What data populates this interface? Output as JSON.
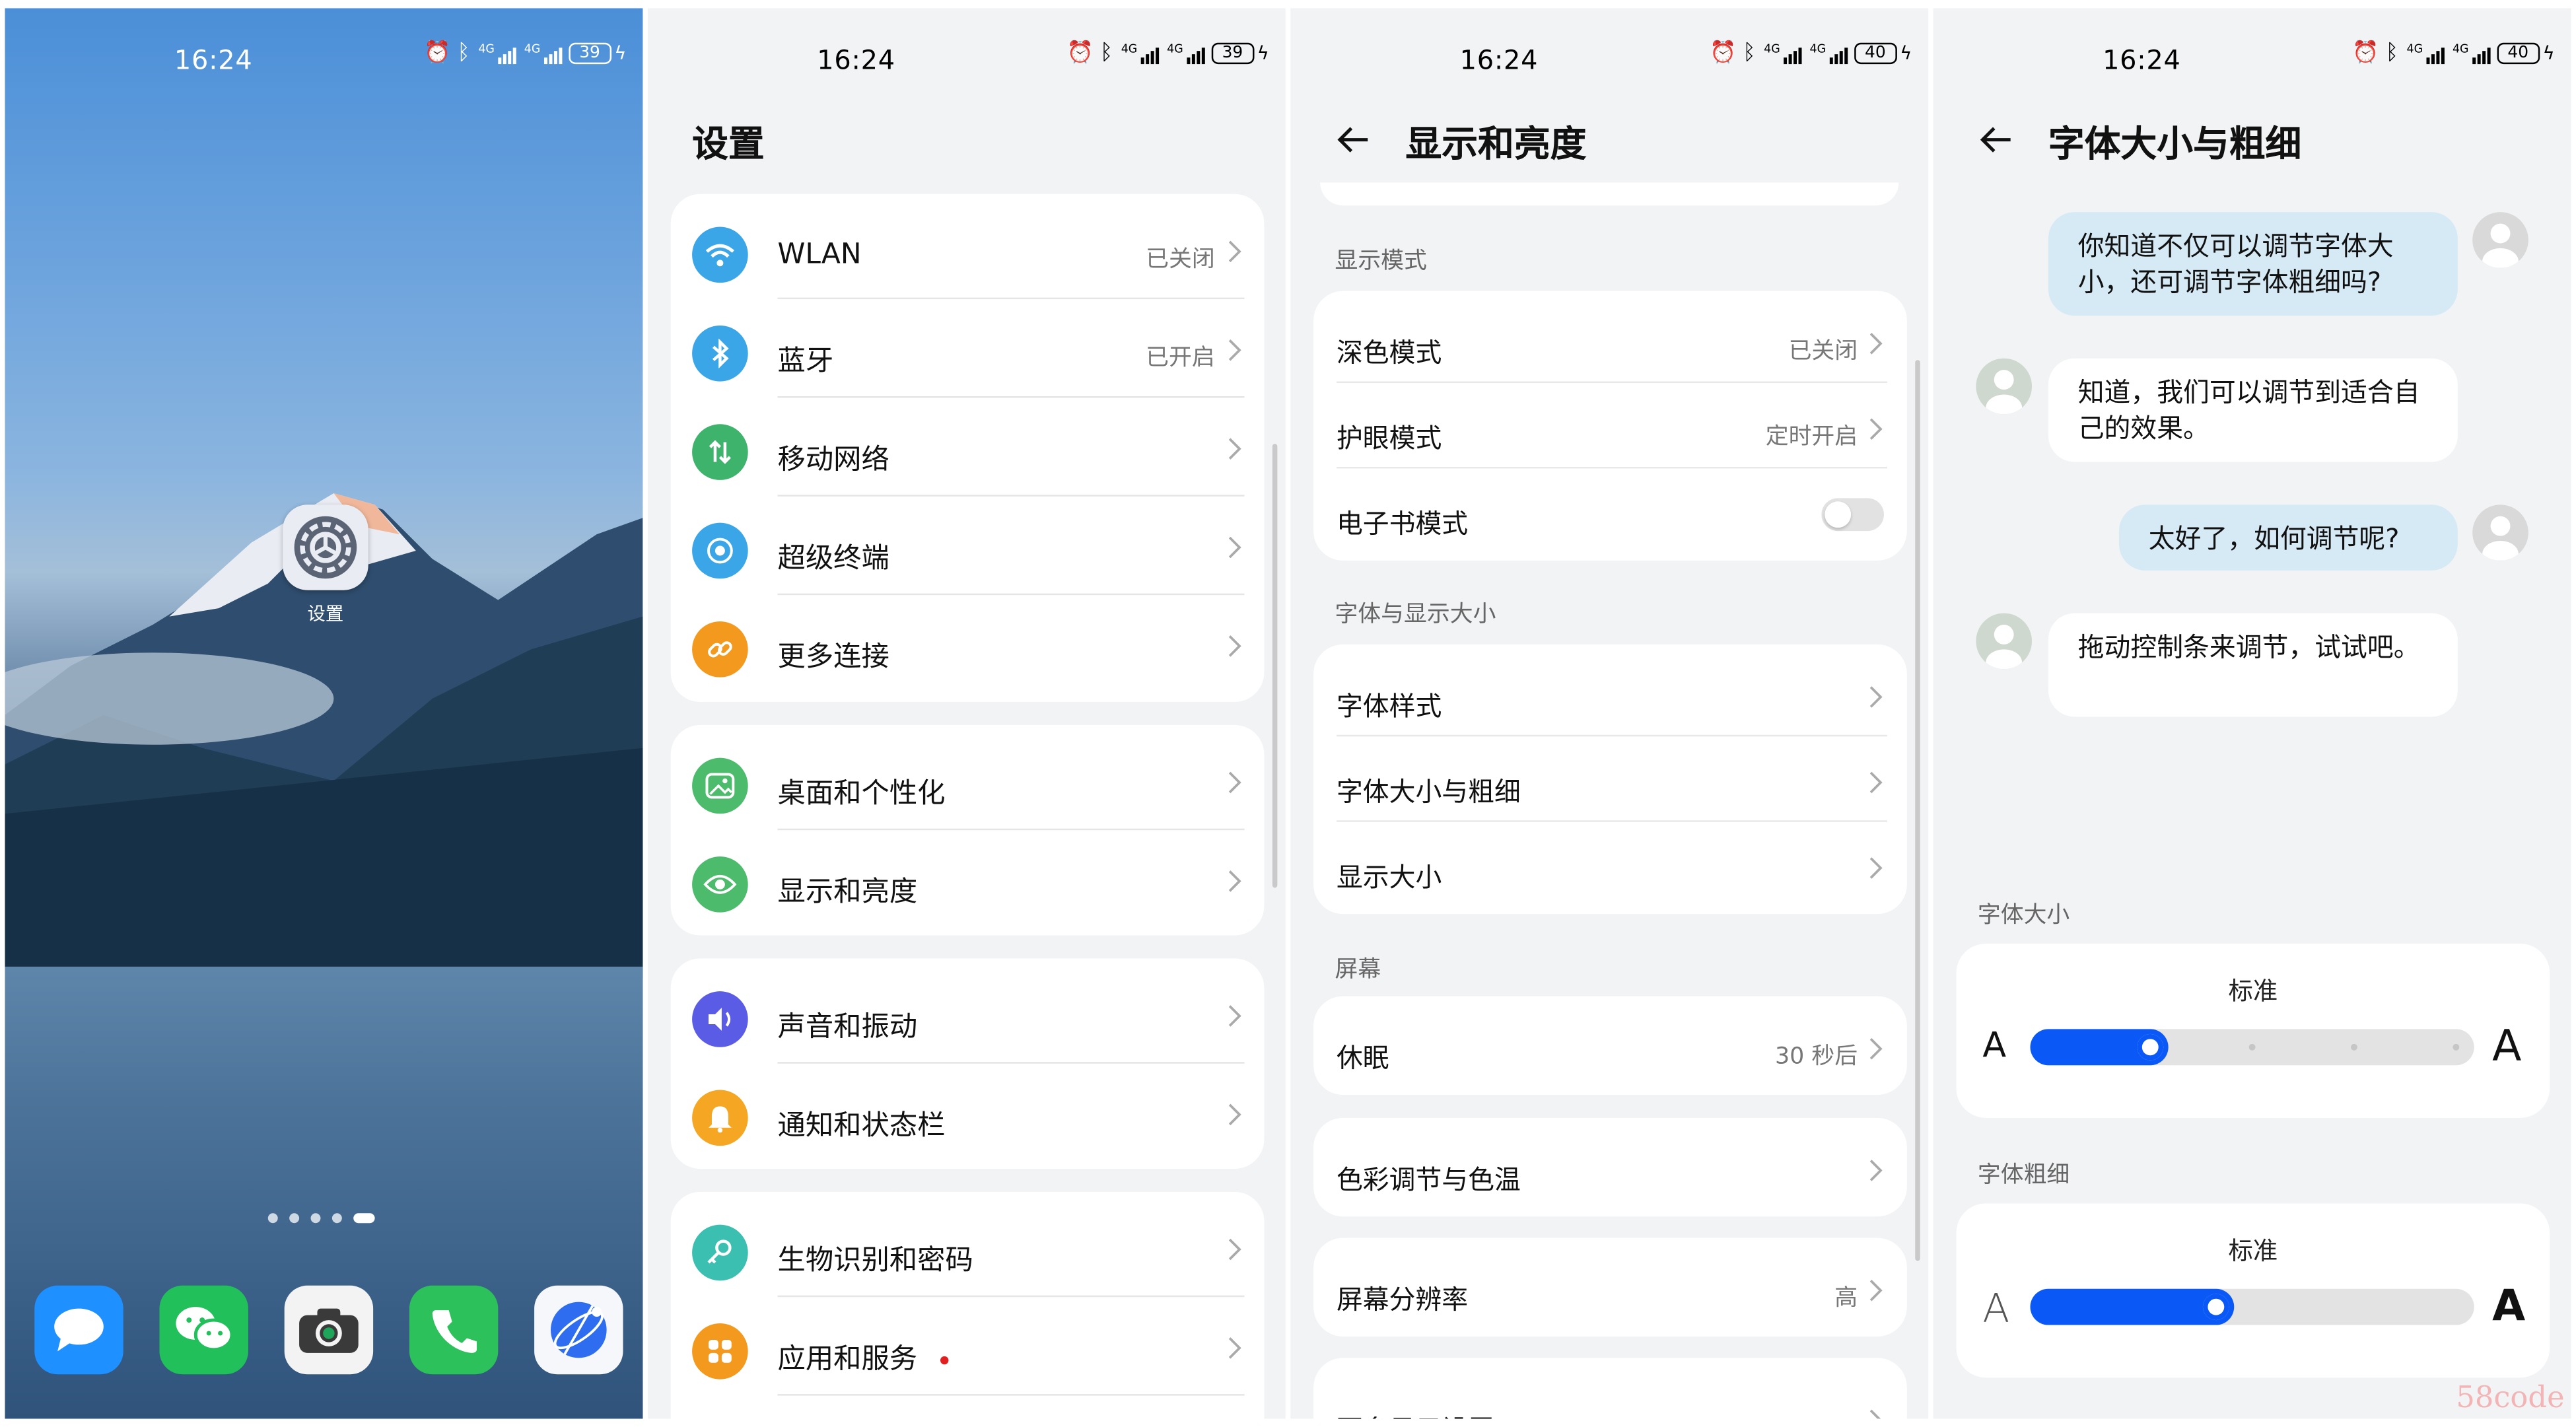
{
  "status": {
    "panel1": {
      "time": "16:24",
      "battery": "39"
    },
    "panel2": {
      "time": "16:24",
      "battery": "39"
    },
    "panel3": {
      "time": "16:24",
      "battery": "40"
    },
    "panel4": {
      "time": "16:24",
      "battery": "40"
    },
    "net_label": "4G"
  },
  "home": {
    "app_label": "设置",
    "page_count": 5,
    "active_page": 5,
    "dock": [
      "messages-icon",
      "wechat-icon",
      "camera-icon",
      "phone-icon",
      "browser-icon"
    ]
  },
  "settings": {
    "title": "设置",
    "groups": [
      [
        {
          "label": "WLAN",
          "value": "已关闭",
          "icon": "wifi-icon",
          "color": "#3aa6e8"
        },
        {
          "label": "蓝牙",
          "value": "已开启",
          "icon": "bluetooth-icon",
          "color": "#3aa6e8"
        },
        {
          "label": "移动网络",
          "value": "",
          "icon": "mobile-data-icon",
          "color": "#3db36b"
        },
        {
          "label": "超级终端",
          "value": "",
          "icon": "super-device-icon",
          "color": "#3aa6e8"
        },
        {
          "label": "更多连接",
          "value": "",
          "icon": "link-icon",
          "color": "#f39a1e"
        }
      ],
      [
        {
          "label": "桌面和个性化",
          "value": "",
          "icon": "image-icon",
          "color": "#4cbb6c"
        },
        {
          "label": "显示和亮度",
          "value": "",
          "icon": "eye-icon",
          "color": "#4cbb6c"
        }
      ],
      [
        {
          "label": "声音和振动",
          "value": "",
          "icon": "speaker-icon",
          "color": "#5b5ce6"
        },
        {
          "label": "通知和状态栏",
          "value": "",
          "icon": "bell-icon",
          "color": "#f5a623"
        }
      ],
      [
        {
          "label": "生物识别和密码",
          "value": "",
          "icon": "key-icon",
          "color": "#3bbfb0"
        },
        {
          "label": "应用和服务",
          "value": "",
          "icon": "apps-icon",
          "color": "#f39a1e",
          "badge": true
        }
      ]
    ]
  },
  "display": {
    "title": "显示和亮度",
    "sections": [
      {
        "header": "显示模式",
        "rows": [
          {
            "label": "深色模式",
            "value": "已关闭"
          },
          {
            "label": "护眼模式",
            "value": "定时开启"
          },
          {
            "label": "电子书模式",
            "toggle": false
          }
        ]
      },
      {
        "header": "字体与显示大小",
        "rows": [
          {
            "label": "字体样式",
            "value": ""
          },
          {
            "label": "字体大小与粗细",
            "value": ""
          },
          {
            "label": "显示大小",
            "value": ""
          }
        ]
      },
      {
        "header": "屏幕",
        "rows": [
          {
            "label": "休眠",
            "value": "30 秒后"
          }
        ]
      }
    ],
    "color_row": "色彩调节与色温",
    "resolution_row": {
      "label": "屏幕分辨率",
      "value": "高"
    },
    "more_row": "更多显示设置"
  },
  "font": {
    "title": "字体大小与粗细",
    "chat": [
      {
        "from": "me",
        "text": "你知道不仅可以调节字体大小，还可调节字体粗细吗?"
      },
      {
        "from": "them",
        "text": "知道，我们可以调节到适合自己的效果。"
      },
      {
        "from": "me",
        "text": "太好了，如何调节呢?"
      },
      {
        "from": "them",
        "text": "拖动控制条来调节，试试吧。"
      }
    ],
    "size": {
      "header": "字体大小",
      "level_label": "标准",
      "small_a": "A",
      "big_a": "A",
      "value": 0.25,
      "steps": 5
    },
    "weight": {
      "header": "字体粗细",
      "level_label": "标准",
      "small_a": "A",
      "big_a": "A",
      "value": 0.41
    }
  },
  "accent_color": "#0a59f7",
  "watermark": "58code"
}
